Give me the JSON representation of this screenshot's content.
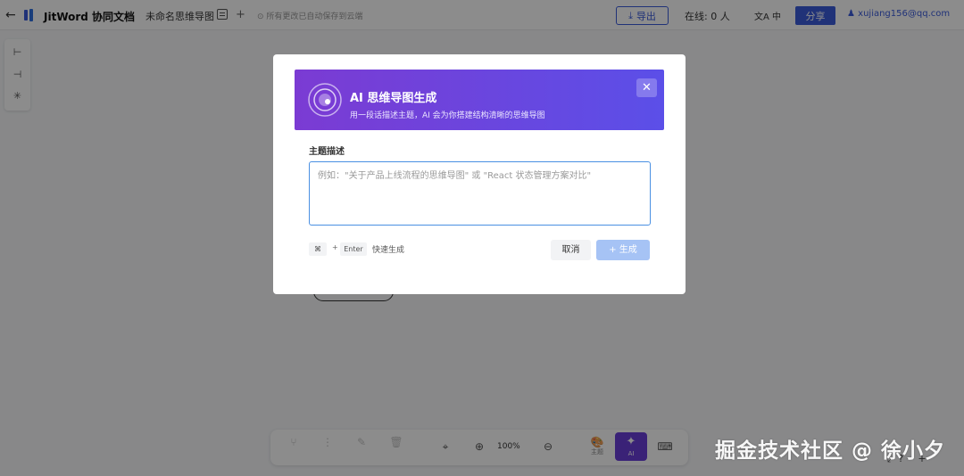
{
  "header": {
    "brand": "JitWord 协同文档",
    "doc_name": "未命名思维导图",
    "saved_status": "所有更改已自动保存到云端",
    "export_label": "导出",
    "online": "在线: 0 人",
    "lang": "中",
    "share_label": "分享",
    "user_email": "xujiang156@qq.com"
  },
  "bottom_toolbar": {
    "zoom": "100%",
    "theme_label": "主题",
    "ai_label": "AI"
  },
  "modal": {
    "title": "AI 思维导图生成",
    "subtitle": "用一段话描述主题，AI 会为你搭建结构清晰的思维导图",
    "field_label": "主题描述",
    "placeholder": "例如：\"关于产品上线流程的思维导图\" 或 \"React 状态管理方案对比\"",
    "shortcut_key1": "⌘",
    "shortcut_plus": "+",
    "shortcut_key2": "Enter",
    "shortcut_hint": "快速生成",
    "cancel_label": "取消",
    "generate_label": "+ 生成"
  },
  "watermark": "掘金技术社区 @ 徐小夕",
  "colors": {
    "accent": "#3b5bdb",
    "banner_start": "#7b3bd3",
    "banner_end": "#5b4fe8",
    "ai_button": "#6b3fd9",
    "generate_disabled": "#a6c3f5"
  }
}
